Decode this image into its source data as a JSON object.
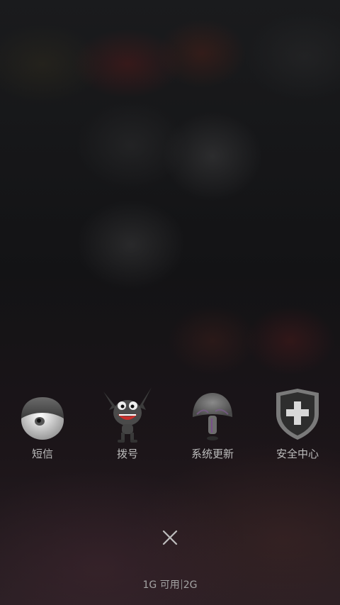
{
  "dock": {
    "apps": [
      {
        "label": "短信",
        "icon": "eyeball-icon"
      },
      {
        "label": "拨号",
        "icon": "bat-monster-icon"
      },
      {
        "label": "系统更新",
        "icon": "mushroom-icon"
      },
      {
        "label": "安全中心",
        "icon": "shield-cross-icon"
      }
    ]
  },
  "close": {
    "icon": "close-icon"
  },
  "memory": {
    "available": "1G 可用",
    "total": "2G"
  }
}
